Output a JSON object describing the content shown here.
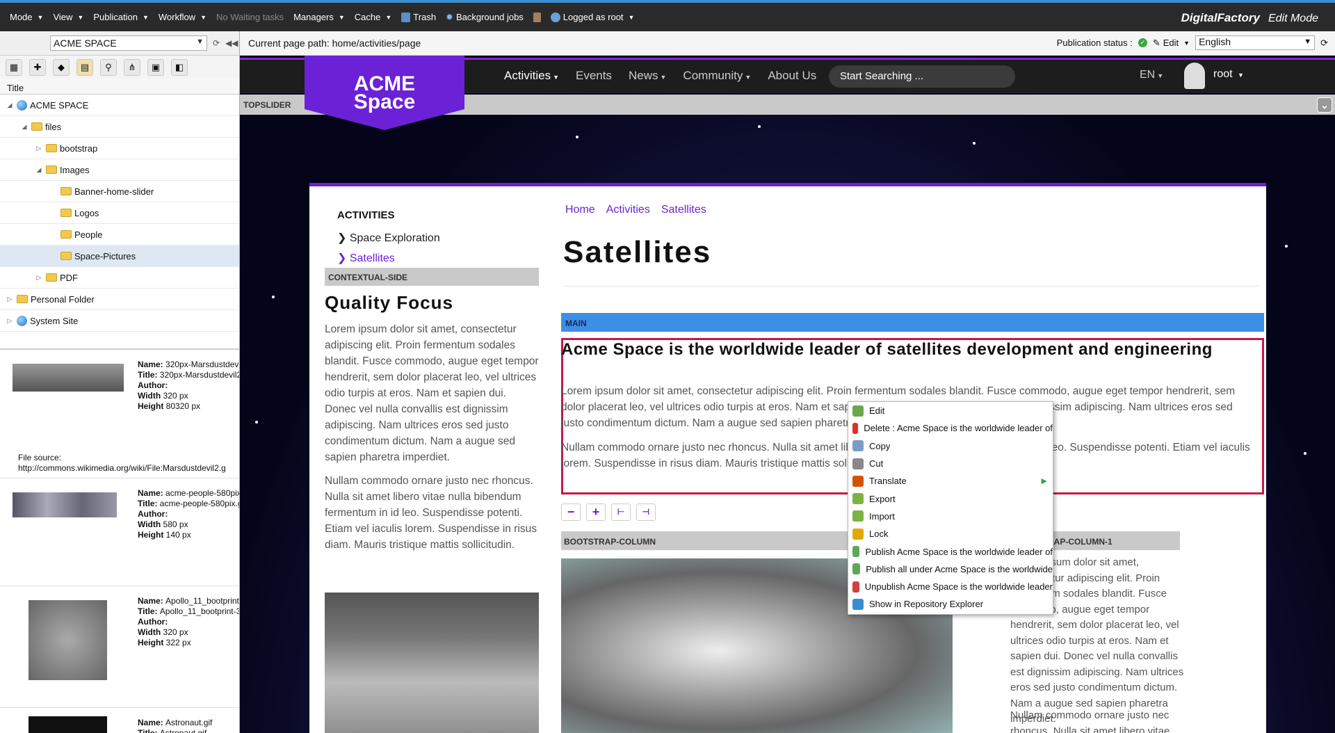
{
  "topbar": {
    "mode": "Mode",
    "view": "View",
    "publication": "Publication",
    "workflow": "Workflow",
    "no_tasks": "No Waiting tasks",
    "managers": "Managers",
    "cache": "Cache",
    "trash": "Trash",
    "background_jobs": "Background jobs",
    "logged_as": "Logged as root",
    "brand": "DigitalFactory",
    "brand_mode": "Edit Mode"
  },
  "left": {
    "site": "ACME SPACE",
    "tree_header": "Title",
    "tree": [
      {
        "label": "ACME SPACE",
        "depth": 0,
        "toggle": "◢",
        "icon": "globe"
      },
      {
        "label": "files",
        "depth": 1,
        "toggle": "◢",
        "icon": "folder"
      },
      {
        "label": "bootstrap",
        "depth": 2,
        "toggle": "▷",
        "icon": "folder"
      },
      {
        "label": "Images",
        "depth": 2,
        "toggle": "◢",
        "icon": "folder"
      },
      {
        "label": "Banner-home-slider",
        "depth": 3,
        "toggle": "",
        "icon": "folder"
      },
      {
        "label": "Logos",
        "depth": 3,
        "toggle": "",
        "icon": "folder"
      },
      {
        "label": "People",
        "depth": 3,
        "toggle": "",
        "icon": "folder"
      },
      {
        "label": "Space-Pictures",
        "depth": 3,
        "toggle": "",
        "icon": "folder",
        "selected": true
      },
      {
        "label": "PDF",
        "depth": 2,
        "toggle": "▷",
        "icon": "folder"
      },
      {
        "label": "Personal Folder",
        "depth": 0,
        "toggle": "▷",
        "icon": "folder"
      },
      {
        "label": "System Site",
        "depth": 0,
        "toggle": "▷",
        "icon": "globe"
      }
    ],
    "thumbs": [
      {
        "name": "320px-Marsdustdevil2.gif",
        "title": "320px-Marsdustdevil2.gif",
        "author": "",
        "width": "320 px",
        "height": "80320 px",
        "source_label": "File source:",
        "source": "http://commons.wikimedia.org/wiki/File:Marsdustdevil2.g"
      },
      {
        "name": "acme-people-580pix.gif",
        "title": "acme-people-580pix.gif",
        "author": "",
        "width": "580 px",
        "height": "140 px"
      },
      {
        "name": "Apollo_11_bootprint-320px.gif",
        "title": "Apollo_11_bootprint-320px.gif",
        "author": "",
        "width": "320 px",
        "height": "322 px"
      },
      {
        "name": "Astronaut.gif",
        "title": "Astronaut.gif"
      }
    ]
  },
  "pathbar": {
    "path": "Current page path: home/activities/page",
    "pub_status": "Publication status :",
    "edit": "Edit",
    "language": "English"
  },
  "site_nav": {
    "logo_line1": "ACME",
    "logo_line2": "Space",
    "items": [
      "Activities",
      "Events",
      "News",
      "Community",
      "About Us"
    ],
    "search": "Start Searching ...",
    "lang": "EN",
    "user": "root",
    "topslider": "TOPSLIDER"
  },
  "content": {
    "side_title": "ACTIVITIES",
    "side_links": [
      "Space Exploration",
      "Satellites"
    ],
    "contextual": "CONTEXTUAL-SIDE",
    "quality": "Quality Focus",
    "side_p1": "Lorem ipsum dolor sit amet, consectetur adipiscing elit. Proin fermentum sodales blandit. Fusce commodo, augue eget tempor hendrerit, sem dolor placerat leo, vel ultrices odio turpis at eros. Nam et sapien dui. Donec vel nulla convallis est dignissim adipiscing. Nam ultrices eros sed justo condimentum dictum. Nam a augue sed sapien pharetra imperdiet.",
    "side_p2": "Nullam commodo ornare justo nec rhoncus. Nulla sit amet libero vitae nulla bibendum fermentum in id leo. Suspendisse potenti. Etiam vel iaculis lorem. Suspendisse in risus diam. Mauris tristique mattis sollicitudin.",
    "crumbs": [
      "Home",
      "Activities",
      "Satellites"
    ],
    "title": "Satellites",
    "main_label": "MAIN",
    "headline": "Acme Space is the worldwide leader of satellites development and engineering",
    "main_p1": "Lorem ipsum dolor sit amet, consectetur adipiscing elit. Proin fermentum sodales blandit. Fusce commodo, augue eget tempor hendrerit, sem dolor placerat leo, vel ultrices odio turpis at eros. Nam et sapien dui. Donec vel nulla convallis est dignissim adipiscing. Nam ultrices eros sed justo condimentum dictum. Nam a augue sed sapien pharetra imperdiet.",
    "main_p2": "Nullam commodo ornare justo nec rhoncus. Nulla sit amet libero vitae nulla bibendum fermentum in id leo. Suspendisse potenti. Etiam vel iaculis lorem. Suspendisse in risus diam. Mauris tristique mattis sollicitudin.",
    "col_label": "BOOTSTRAP-COLUMN",
    "col_label2": "BOOTSTRAP-COLUMN-1",
    "col_p1": "Lorem ipsum dolor sit amet, consectetur adipiscing elit. Proin fermentum sodales blandit. Fusce commodo, augue eget tempor hendrerit, sem dolor placerat leo, vel ultrices odio turpis at eros. Nam et sapien dui. Donec vel nulla convallis est dignissim adipiscing. Nam ultrices eros sed justo condimentum dictum. Nam a augue sed sapien pharetra imperdiet.",
    "col_p2": "Nullam commodo ornare justo nec rhoncus. Nulla sit amet libero vitae nulla bibendum"
  },
  "context_menu": [
    {
      "label": "Edit",
      "icon": "pencil-icon",
      "color": "#6aa84f"
    },
    {
      "label": "Delete : Acme Space is the worldwide leader of",
      "icon": "delete-icon",
      "color": "#e03020"
    },
    {
      "label": "Copy",
      "icon": "copy-icon",
      "color": "#7a9cc6"
    },
    {
      "label": "Cut",
      "icon": "cut-icon",
      "color": "#888888"
    },
    {
      "label": "Translate",
      "icon": "translate-icon",
      "color": "#d35400",
      "submenu": true
    },
    {
      "label": "Export",
      "icon": "export-icon",
      "color": "#7cb342"
    },
    {
      "label": "Import",
      "icon": "import-icon",
      "color": "#7cb342"
    },
    {
      "label": "Lock",
      "icon": "lock-icon",
      "color": "#e0a800"
    },
    {
      "label": "Publish Acme Space is the worldwide leader of",
      "icon": "publish-icon",
      "color": "#5aa85a"
    },
    {
      "label": "Publish all under Acme Space is the worldwide",
      "icon": "publish-all-icon",
      "color": "#5aa85a"
    },
    {
      "label": "Unpublish Acme Space is the worldwide leader",
      "icon": "unpublish-icon",
      "color": "#d04040"
    },
    {
      "label": "Show in Repository Explorer",
      "icon": "repository-icon",
      "color": "#3a8ed0"
    }
  ]
}
